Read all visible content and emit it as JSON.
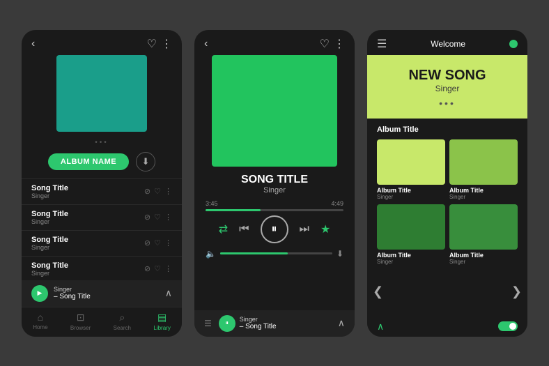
{
  "phone1": {
    "header": {
      "back_icon": "‹",
      "heart_icon": "♡",
      "more_icon": "⋮"
    },
    "album_art_color": "#1a9e8a",
    "dots": "•••",
    "album_name_btn": "ALBUM NAME",
    "download_icon": "⬇",
    "songs": [
      {
        "title": "Song Title",
        "singer": "Singer"
      },
      {
        "title": "Song Title",
        "singer": "Singer"
      },
      {
        "title": "Song Title",
        "singer": "Singer"
      },
      {
        "title": "Song Title",
        "singer": "Singer"
      }
    ],
    "now_playing": {
      "singer": "Singer",
      "song": "Song Title"
    },
    "nav": [
      {
        "label": "Home",
        "icon": "⌂",
        "active": false
      },
      {
        "label": "Browser",
        "icon": "⊡",
        "active": false
      },
      {
        "label": "Search",
        "icon": "⌕",
        "active": false
      },
      {
        "label": "Library",
        "icon": "▤",
        "active": true
      }
    ]
  },
  "phone2": {
    "header": {
      "back_icon": "‹",
      "heart_icon": "♡",
      "more_icon": "⋮"
    },
    "album_art_color": "#22c45e",
    "song_title": "SONG TITLE",
    "song_singer": "Singer",
    "time_elapsed": "3:45",
    "time_total": "4:49",
    "controls": {
      "shuffle_icon": "⇄",
      "prev_icon": "⏮",
      "play_icon": "⏸",
      "next_icon": "⏭",
      "star_icon": "★"
    },
    "now_playing": {
      "singer": "Singer",
      "song": "Song Title"
    }
  },
  "phone3": {
    "header": {
      "menu_icon": "☰",
      "welcome": "Welcome",
      "dot_color": "#2dc76e"
    },
    "hero": {
      "new_song": "NEW SONG",
      "singer": "Singer",
      "dots": "•••",
      "bg_color": "#c8e86a"
    },
    "album_section_label": "Album Title",
    "albums": [
      {
        "title": "Album Title",
        "singer": "Singer",
        "color": "#c8e86a"
      },
      {
        "title": "Album Title",
        "singer": "Singer",
        "color": "#8bc34a"
      },
      {
        "title": "Album Title",
        "singer": "Singer",
        "color": "#2e7d32"
      },
      {
        "title": "Album Title",
        "singer": "Singer",
        "color": "#388e3c"
      }
    ],
    "nav_left": "❮",
    "nav_right": "❯"
  }
}
